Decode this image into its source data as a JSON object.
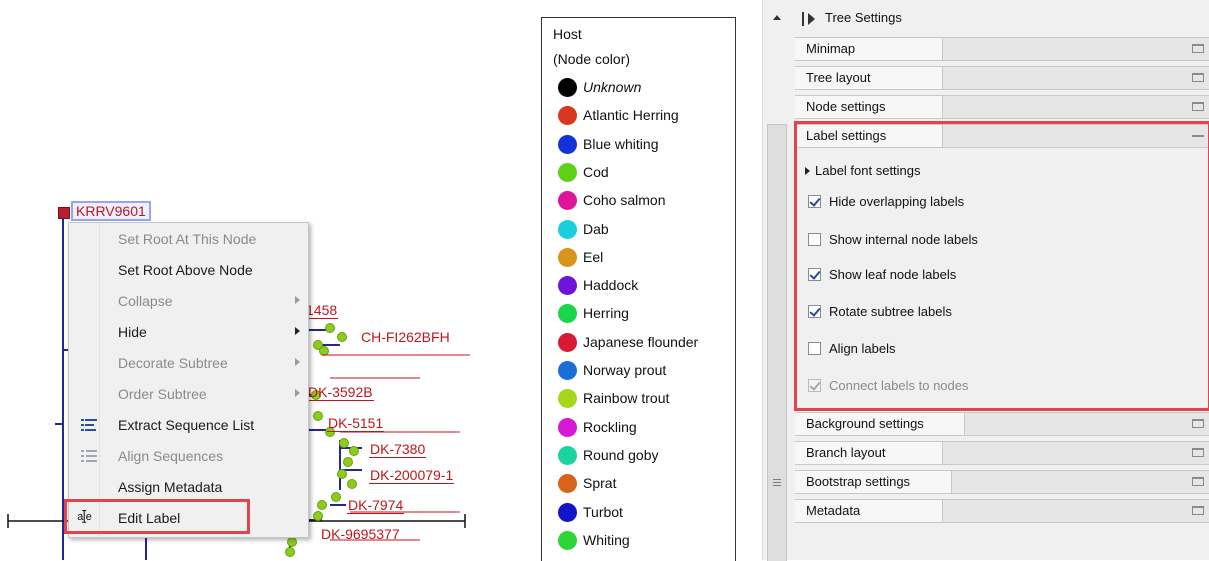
{
  "tree": {
    "selected_node_label": "KRRV9601",
    "leaf_labels": [
      "1458",
      "CH-FI262BFH",
      "DK-3592B",
      "DK-5151",
      "DK-7380",
      "DK-200079-1",
      "DK-7974",
      "DK-9695377"
    ],
    "label_color": "#c0161b",
    "branch_color": "#1f2a8c",
    "node_color": "#8ccc1c"
  },
  "context_menu": {
    "items": [
      {
        "label": "Set Root At This Node",
        "enabled": false
      },
      {
        "label": "Set Root Above Node",
        "enabled": true
      },
      {
        "label": "Collapse",
        "enabled": false,
        "submenu": true
      },
      {
        "label": "Hide",
        "enabled": true,
        "submenu": true
      },
      {
        "label": "Decorate Subtree",
        "enabled": false,
        "submenu": true
      },
      {
        "label": "Order Subtree",
        "enabled": false,
        "submenu": true
      },
      {
        "label": "Extract Sequence List",
        "enabled": true,
        "icon": "sequence-list-icon"
      },
      {
        "label": "Align Sequences",
        "enabled": false,
        "icon": "align-sequences-icon"
      },
      {
        "label": "Assign Metadata",
        "enabled": true
      },
      {
        "label": "Edit Label",
        "enabled": true,
        "icon": "edit-label-icon",
        "highlighted": true
      }
    ]
  },
  "legend": {
    "title": "Host",
    "subtitle": "(Node color)",
    "entries": [
      {
        "label": "Unknown",
        "color": "#000000",
        "italic": true
      },
      {
        "label": "Atlantic Herring",
        "color": "#d9381e"
      },
      {
        "label": "Blue whiting",
        "color": "#1231d6"
      },
      {
        "label": "Cod",
        "color": "#5fd018"
      },
      {
        "label": "Coho salmon",
        "color": "#e0149a"
      },
      {
        "label": "Dab",
        "color": "#19cfdf"
      },
      {
        "label": "Eel",
        "color": "#d9951a"
      },
      {
        "label": "Haddock",
        "color": "#6f14d6"
      },
      {
        "label": "Herring",
        "color": "#18d64a"
      },
      {
        "label": "Japanese flounder",
        "color": "#d81a34"
      },
      {
        "label": "Norway prout",
        "color": "#1a6fd6"
      },
      {
        "label": "Rainbow trout",
        "color": "#a6d81a"
      },
      {
        "label": "Rockling",
        "color": "#d816d6"
      },
      {
        "label": "Round goby",
        "color": "#19d4a0"
      },
      {
        "label": "Sprat",
        "color": "#d6641a"
      },
      {
        "label": "Turbot",
        "color": "#1414c8"
      },
      {
        "label": "Whiting",
        "color": "#2bd636"
      }
    ]
  },
  "panel": {
    "header": "Tree Settings",
    "sections_top": [
      "Minimap",
      "Tree layout",
      "Node settings"
    ],
    "label_settings": {
      "title": "Label settings",
      "font_settings": "Label font settings",
      "options": [
        {
          "label": "Hide overlapping labels",
          "checked": true,
          "enabled": true
        },
        {
          "label": "Show internal node labels",
          "checked": false,
          "enabled": true
        },
        {
          "label": "Show leaf node labels",
          "checked": true,
          "enabled": true
        },
        {
          "label": "Rotate subtree labels",
          "checked": true,
          "enabled": true
        },
        {
          "label": "Align labels",
          "checked": false,
          "enabled": true
        },
        {
          "label": "Connect labels to nodes",
          "checked": true,
          "enabled": false
        }
      ]
    },
    "sections_bottom": [
      "Background settings",
      "Branch layout",
      "Bootstrap settings",
      "Metadata"
    ]
  }
}
